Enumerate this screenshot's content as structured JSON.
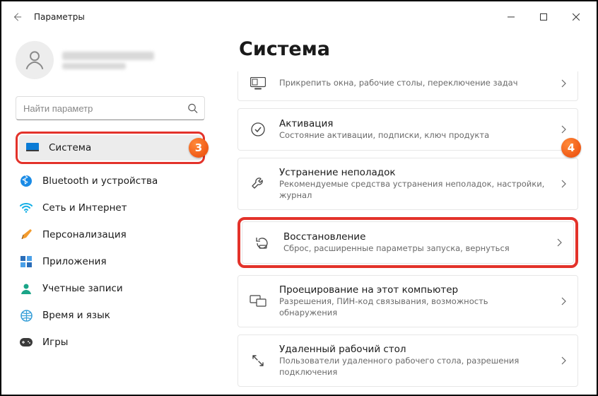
{
  "window": {
    "title": "Параметры"
  },
  "account": {
    "blurred": true
  },
  "search": {
    "placeholder": "Найти параметр"
  },
  "sidebar": {
    "items": [
      {
        "label": "Система",
        "selected": true,
        "icon": "system"
      },
      {
        "label": "Bluetooth и устройства",
        "icon": "bluetooth"
      },
      {
        "label": "Сеть и Интернет",
        "icon": "wifi"
      },
      {
        "label": "Персонализация",
        "icon": "personalize"
      },
      {
        "label": "Приложения",
        "icon": "apps"
      },
      {
        "label": "Учетные записи",
        "icon": "accounts"
      },
      {
        "label": "Время и язык",
        "icon": "time"
      },
      {
        "label": "Игры",
        "icon": "games"
      }
    ]
  },
  "main": {
    "title": "Система",
    "cards": [
      {
        "title": "",
        "subtitle": "Прикрепить окна, рабочие столы, переключение задач",
        "icon": "multitask"
      },
      {
        "title": "Активация",
        "subtitle": "Состояние активации, подписки, ключ продукта",
        "icon": "activation"
      },
      {
        "title": "Устранение неполадок",
        "subtitle": "Рекомендуемые средства устранения неполадок, настройки, журнал",
        "icon": "troubleshoot"
      },
      {
        "title": "Восстановление",
        "subtitle": "Сброс, расширенные параметры запуска, вернуться",
        "icon": "recovery"
      },
      {
        "title": "Проецирование на этот компьютер",
        "subtitle": "Разрешения, ПИН-код связывания, возможность обнаружения",
        "icon": "project"
      },
      {
        "title": "Удаленный рабочий стол",
        "subtitle": "Пользователи удаленного рабочего стола, разрешения подключения",
        "icon": "remote"
      }
    ]
  },
  "annotations": {
    "step3": "3",
    "step4": "4"
  }
}
